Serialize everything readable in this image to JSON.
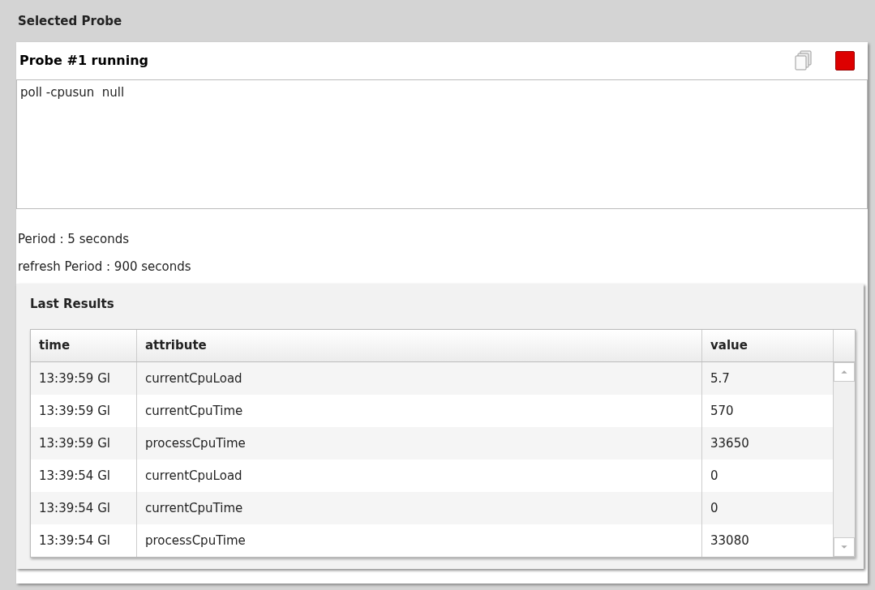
{
  "header": {
    "title": "Selected Probe"
  },
  "probe": {
    "title": "Probe #1 running",
    "running": true,
    "command": "poll -cpusun  null",
    "period": "Period : 5 seconds",
    "refresh_period": "refresh Period : 900 seconds"
  },
  "results": {
    "title": "Last Results",
    "columns": [
      "time",
      "attribute",
      "value"
    ],
    "rows": [
      {
        "time": "13:39:59 Gl",
        "attribute": "currentCpuLoad",
        "value": "5.7"
      },
      {
        "time": "13:39:59 Gl",
        "attribute": "currentCpuTime",
        "value": "570"
      },
      {
        "time": "13:39:59 Gl",
        "attribute": "processCpuTime",
        "value": "33650"
      },
      {
        "time": "13:39:54 Gl",
        "attribute": "currentCpuLoad",
        "value": "0"
      },
      {
        "time": "13:39:54 Gl",
        "attribute": "currentCpuTime",
        "value": "0"
      },
      {
        "time": "13:39:54 Gl",
        "attribute": "processCpuTime",
        "value": "33080"
      }
    ]
  }
}
